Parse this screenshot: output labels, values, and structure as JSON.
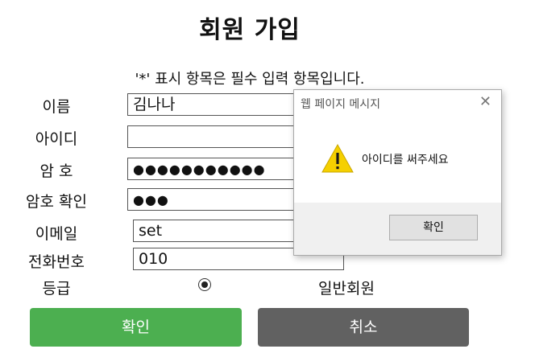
{
  "form": {
    "title": "회원 가입",
    "notice": "'*' 표시 항목은 필수 입력 항목입니다.",
    "fields": {
      "name": {
        "label": "이름",
        "value": "김나나"
      },
      "id": {
        "label": "아이디",
        "value": ""
      },
      "password": {
        "label": "암 호",
        "value": "●●●●●●●●●●●"
      },
      "password_confirm": {
        "label": "암호 확인",
        "value": "●●●"
      },
      "email": {
        "label": "이메일",
        "value": "set"
      },
      "phone": {
        "label": "전화번호",
        "value": "010"
      },
      "grade": {
        "label": "등급",
        "option_label": "일반회원",
        "selected": true
      }
    },
    "buttons": {
      "ok": "확인",
      "cancel": "취소"
    },
    "colors": {
      "ok": "#4caf50",
      "cancel": "#616161"
    }
  },
  "dialog": {
    "title": "웹 페이지 메시지",
    "close_icon": "close-icon",
    "icon": "warning-icon",
    "message": "아이디를 써주세요",
    "ok_label": "확인"
  }
}
